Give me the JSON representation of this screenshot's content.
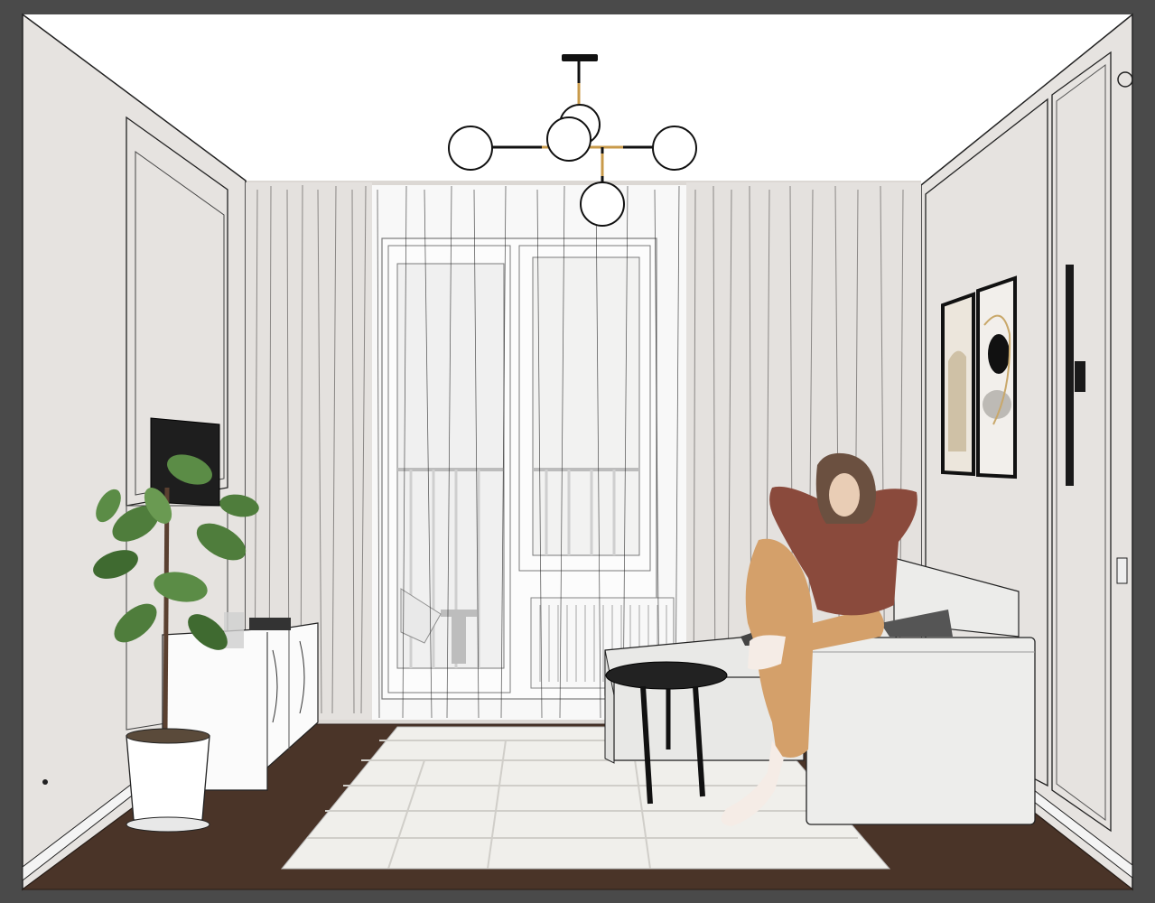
{
  "scene": {
    "colors": {
      "frame": "#4a4a4a",
      "ceiling": "#ffffff",
      "back_wall": "#dcd8d4",
      "side_wall": "#e6e3e0",
      "floor": "#4a3428",
      "curtain": "#e4e1de",
      "sheer": "#f2f1f0",
      "sofa": "#ececea",
      "rug": "#f0efeb",
      "plant_leaf": "#4f7d3c",
      "sweater": "#8a4a3c",
      "pants": "#d4a06a",
      "hair": "#6b5040",
      "table": "#1f1a18",
      "pot": "#ffffff"
    }
  }
}
